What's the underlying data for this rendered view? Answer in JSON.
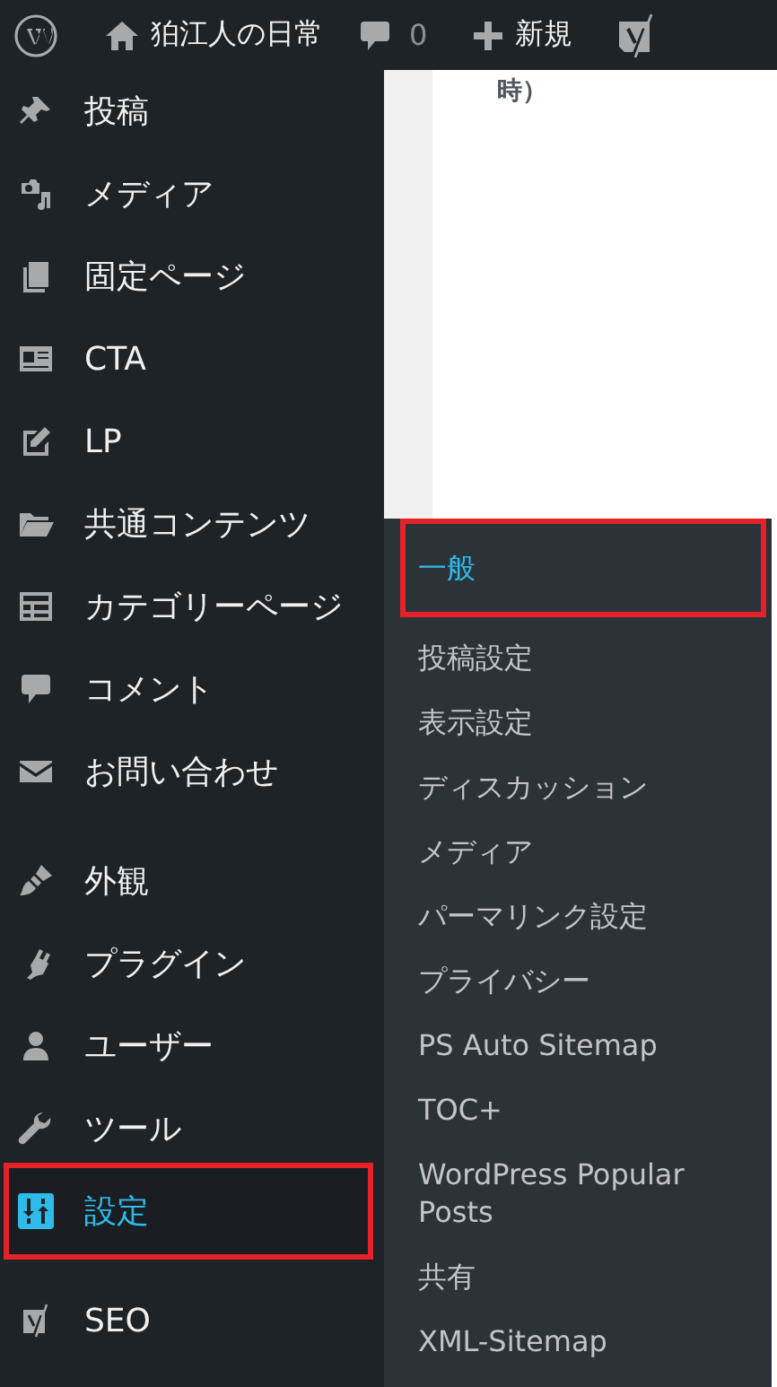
{
  "admin_bar": {
    "site_name": "狛江人の日常",
    "comment_count": "0",
    "new_label": "新規"
  },
  "content": {
    "text": "時）"
  },
  "menu_groups": [
    [
      {
        "kind": "pin",
        "label": "投稿",
        "selected": false,
        "highlighted": false
      },
      {
        "kind": "media",
        "label": "メディア",
        "selected": false,
        "highlighted": false
      },
      {
        "kind": "pages",
        "label": "固定ページ",
        "selected": false,
        "highlighted": false
      },
      {
        "kind": "card",
        "label": "CTA",
        "selected": false,
        "highlighted": false
      },
      {
        "kind": "edit",
        "label": "LP",
        "selected": false,
        "highlighted": false
      },
      {
        "kind": "folder",
        "label": "共通コンテンツ",
        "selected": false,
        "highlighted": false
      },
      {
        "kind": "grid",
        "label": "カテゴリーページ",
        "selected": false,
        "highlighted": false
      },
      {
        "kind": "comment",
        "label": "コメント",
        "selected": false,
        "highlighted": false
      },
      {
        "kind": "mail",
        "label": "お問い合わせ",
        "selected": false,
        "highlighted": false
      }
    ],
    [
      {
        "kind": "brush",
        "label": "外観",
        "selected": false,
        "highlighted": false
      },
      {
        "kind": "plug",
        "label": "プラグイン",
        "selected": false,
        "highlighted": false
      },
      {
        "kind": "user",
        "label": "ユーザー",
        "selected": false,
        "highlighted": false
      },
      {
        "kind": "wrench",
        "label": "ツール",
        "selected": false,
        "highlighted": false
      },
      {
        "kind": "sliders",
        "label": "設定",
        "selected": true,
        "highlighted": true
      }
    ],
    [
      {
        "kind": "yoast",
        "label": "SEO",
        "selected": false,
        "highlighted": false
      }
    ]
  ],
  "submenu": [
    {
      "label": "一般",
      "selected": true,
      "highlighted": true
    },
    {
      "label": "投稿設定",
      "selected": false,
      "highlighted": false
    },
    {
      "label": "表示設定",
      "selected": false,
      "highlighted": false
    },
    {
      "label": "ディスカッション",
      "selected": false,
      "highlighted": false
    },
    {
      "label": "メディア",
      "selected": false,
      "highlighted": false
    },
    {
      "label": "パーマリンク設定",
      "selected": false,
      "highlighted": false
    },
    {
      "label": "プライバシー",
      "selected": false,
      "highlighted": false
    },
    {
      "label": "PS Auto Sitemap",
      "selected": false,
      "highlighted": false
    },
    {
      "label": "TOC+",
      "selected": false,
      "highlighted": false
    },
    {
      "label": "WordPress Popular Posts",
      "selected": false,
      "highlighted": false
    },
    {
      "label": "共有",
      "selected": false,
      "highlighted": false
    },
    {
      "label": "XML-Sitemap",
      "selected": false,
      "highlighted": false
    }
  ]
}
